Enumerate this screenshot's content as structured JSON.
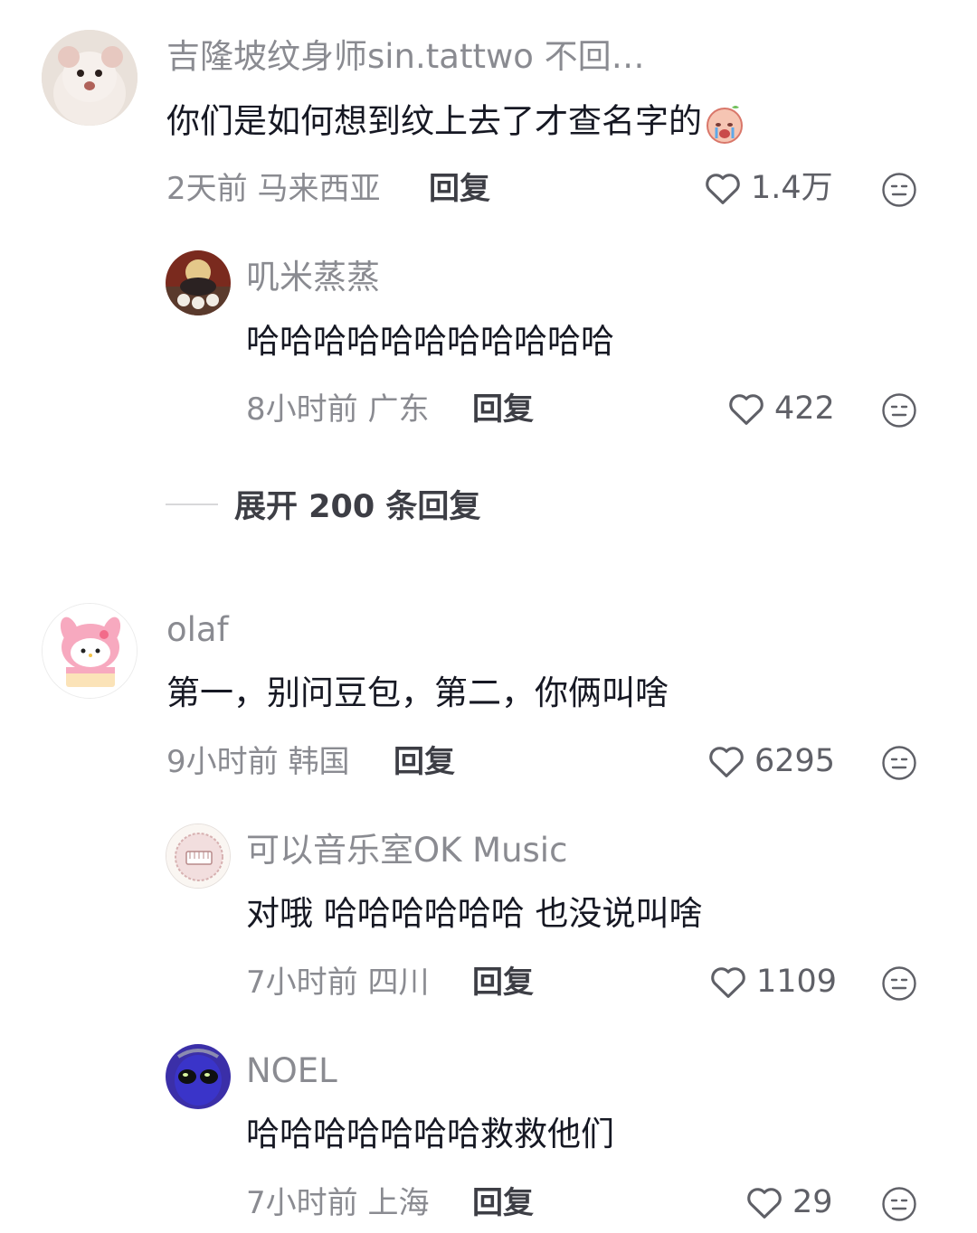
{
  "comments": [
    {
      "username": "吉隆坡纹身师sin.tattwo 不回…",
      "text": "你们是如何想到纹上去了才查名字的",
      "emoji": "crying-face-emoji",
      "meta": "2天前 马来西亚",
      "reply_label": "回复",
      "likes": "1.4万",
      "avatar": "hamster-avatar"
    },
    {
      "username": "叽米蒸蒸",
      "text": "哈哈哈哈哈哈哈哈哈哈哈",
      "meta": "8小时前 广东",
      "reply_label": "回复",
      "likes": "422",
      "avatar": "person-avatar"
    },
    {
      "username": "olaf",
      "text": "第一，别问豆包，第二，你俩叫啥",
      "meta": "9小时前 韩国",
      "reply_label": "回复",
      "likes": "6295",
      "avatar": "my-melody-avatar"
    },
    {
      "username": "可以音乐室OK Music",
      "text": "对哦  哈哈哈哈哈哈 也没说叫啥",
      "meta": "7小时前 四川",
      "reply_label": "回复",
      "likes": "1109",
      "avatar": "piano-logo-avatar"
    },
    {
      "username": "NOEL",
      "text": "哈哈哈哈哈哈哈救救他们",
      "meta": "7小时前 上海",
      "reply_label": "回复",
      "likes": "29",
      "avatar": "alien-avatar"
    }
  ],
  "expand_replies": "展开 200 条回复",
  "colors": {
    "secondary_text": "#8a8b91",
    "primary_text": "#161823",
    "divider": "#d8d8da"
  }
}
